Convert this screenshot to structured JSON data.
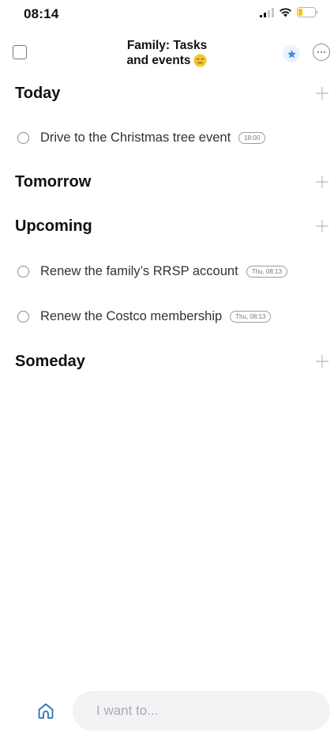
{
  "status_bar": {
    "time": "08:14"
  },
  "header": {
    "title_line1": "Family: Tasks",
    "title_line2": "and events",
    "title_emoji": "expressionless-face",
    "star_color": "#3a8ee6"
  },
  "sections": {
    "today": {
      "title": "Today",
      "tasks": [
        {
          "text": "Drive to the Christmas tree event",
          "badge": "18:00"
        }
      ]
    },
    "tomorrow": {
      "title": "Tomorrow",
      "tasks": []
    },
    "upcoming": {
      "title": "Upcoming",
      "tasks": [
        {
          "text": "Renew the family’s RRSP account",
          "badge": "Thu, 08:13"
        },
        {
          "text": "Renew the Costco membership",
          "badge": "Thu, 08:13"
        }
      ]
    },
    "someday": {
      "title": "Someday",
      "tasks": []
    }
  },
  "bottom": {
    "input_placeholder": "I want to...",
    "home_color": "#2f6fb5"
  },
  "icons": {
    "add": "plus-icon",
    "home": "home-icon",
    "star": "star-icon",
    "more": "ellipsis-icon"
  }
}
